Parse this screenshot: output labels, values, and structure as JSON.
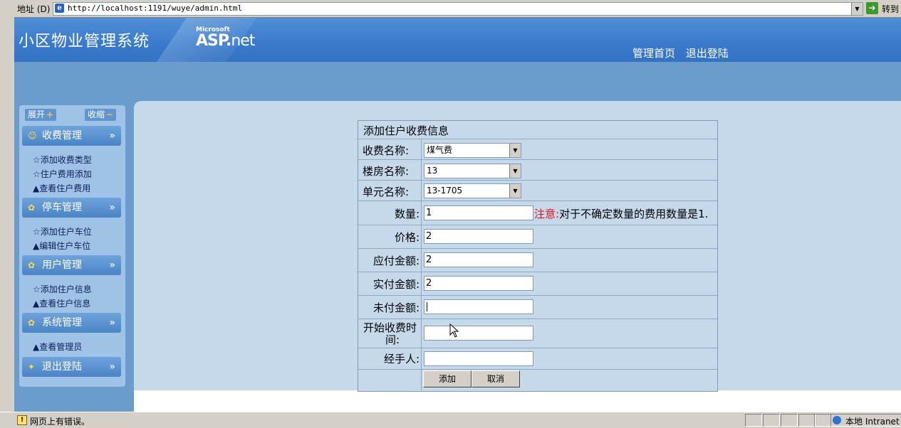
{
  "browser": {
    "address_label": "地址 (D)",
    "url": "http://localhost:1191/wuye/admin.html",
    "go_label": "转到"
  },
  "header": {
    "title": "小区物业管理系统",
    "logo_small": "Microsoft",
    "logo_asp": "ASP.",
    "logo_net": "net",
    "nav": [
      "管理首页",
      "退出登陆"
    ]
  },
  "sidebar": {
    "expand_label": "展开",
    "collapse_label": "收缩",
    "sections": [
      {
        "title": "收费管理",
        "items": [
          "☆添加收费类型",
          "☆住户费用添加",
          "▲查看住户费用"
        ]
      },
      {
        "title": "停车管理",
        "items": [
          "☆添加住户车位",
          "▲编辑住户车位"
        ]
      },
      {
        "title": "用户管理",
        "items": [
          "☆添加住户信息",
          "▲查看住户信息"
        ]
      },
      {
        "title": "系统管理",
        "items": [
          "▲查看管理员"
        ]
      },
      {
        "title": "退出登陆",
        "items": []
      }
    ]
  },
  "form": {
    "caption": "添加住户收费信息",
    "fee_name_label": "收费名称:",
    "fee_name_value": "煤气费",
    "building_label": "楼房名称:",
    "building_value": "13",
    "unit_label": "单元名称:",
    "unit_value": "13-1705",
    "qty_label": "数量:",
    "qty_value": "1",
    "note_prefix": "注意:",
    "note_text": "对于不确定数量的费用数量是1.",
    "price_label": "价格:",
    "price_value": "2",
    "payable_label": "应付金额:",
    "payable_value": "2",
    "paid_label": "实付金额:",
    "paid_value": "2",
    "unpaid_label": "未付金额:",
    "unpaid_value": "",
    "start_label_1": "开始收费时",
    "start_label_2": "间:",
    "start_value": "",
    "handler_label": "经手人:",
    "handler_value": "",
    "add_button": "添加",
    "cancel_button": "取消"
  },
  "status": {
    "message": "网页上有错误。",
    "zone": "本地 Intranet"
  }
}
